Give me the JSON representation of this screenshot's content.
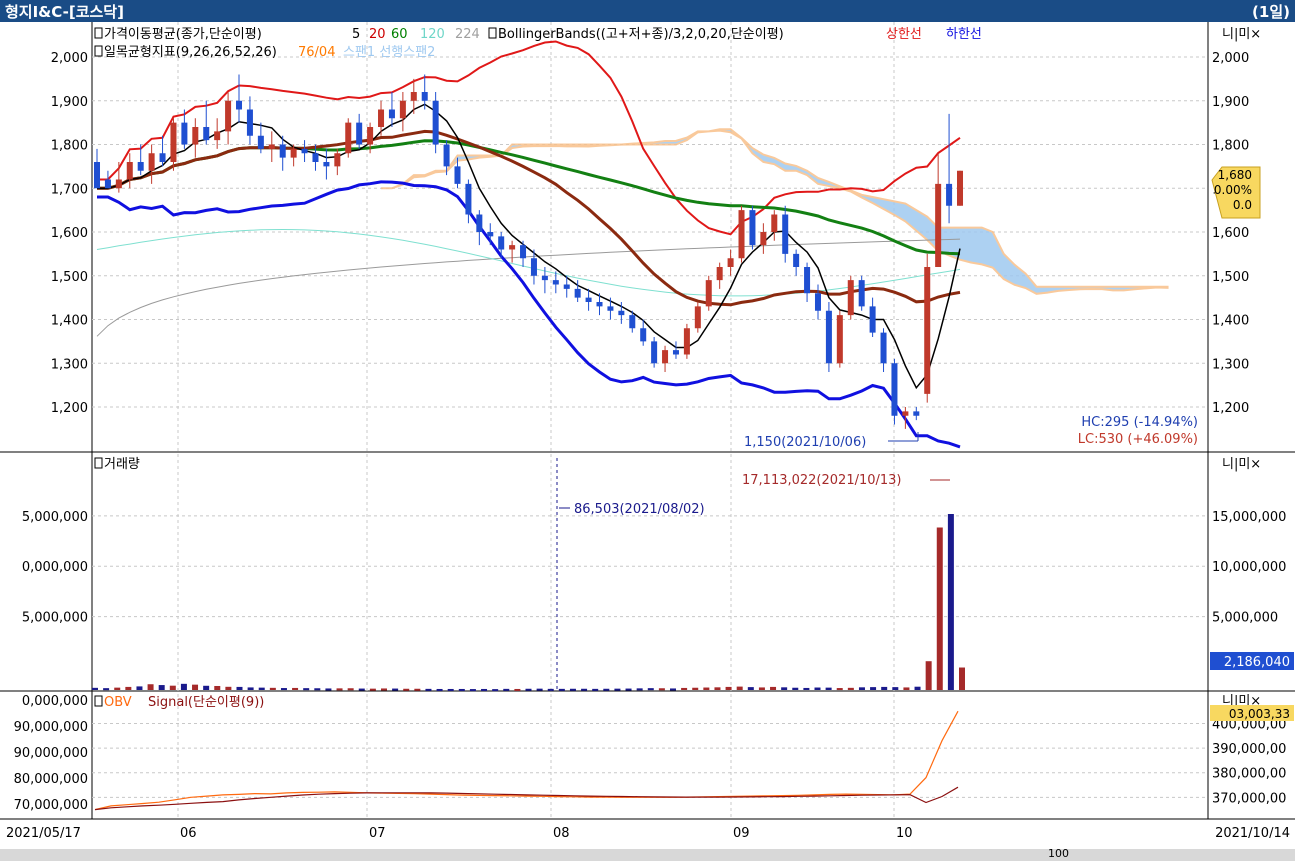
{
  "window": {
    "title": "형지I&C-[코스닥]",
    "period": "(1일)"
  },
  "panels": {
    "price": {
      "ma_label": "가격이동평균(종가,단순이평)",
      "ma_periods": [
        {
          "label": "5",
          "color": "#000000"
        },
        {
          "label": "20",
          "color": "#cc0000"
        },
        {
          "label": "60",
          "color": "#008000"
        },
        {
          "label": "120",
          "color": "#6fd6c8"
        },
        {
          "label": "224",
          "color": "#a0a0a0"
        }
      ],
      "bb_label": "BollingerBands((고+저+종)/3,2,0,20,단순이평)",
      "bb_upper_label": "상한선",
      "bb_lower_label": "하한선",
      "ichimoku_label": "일목균형지표(9,26,26,52,26)",
      "ichimoku_overlap": "76/04",
      "span_labels": "스팬1 선행스팬2",
      "y_ticks": [
        "2,000",
        "1,900",
        "1,800",
        "1,700",
        "1,600",
        "1,500",
        "1,400",
        "1,300",
        "1,200"
      ],
      "current_value": "1,680",
      "current_change": "0.00%",
      "current_diff": "0.0",
      "low_marker": "1,150(2021/10/06)",
      "hc_label": "HC:295 (-14.94%)",
      "lc_label": "LC:530 (+46.09%)"
    },
    "volume": {
      "label": "거래량",
      "y_ticks_left": [
        "5,000,000",
        "0,000,000",
        "5,000,000"
      ],
      "y_ticks_right": [
        "15,000,000",
        "10,000,000",
        "5,000,000"
      ],
      "max_marker": "17,113,022(2021/10/13)",
      "min_marker": "86,503(2021/08/02)",
      "current_value": "2,186,040"
    },
    "obv": {
      "label": "OBV",
      "signal_label": "Signal(단순이평(9))",
      "y_ticks_left": [
        "0,000,000",
        "90,000,000",
        "90,000,000",
        "80,000,000",
        "70,000,000"
      ],
      "y_ticks_right": [
        "400,000,00",
        "390,000,00",
        "380,000,00",
        "370,000,00"
      ],
      "current_value": "03,003,33"
    }
  },
  "x_axis": {
    "start_date": "2021/05/17",
    "end_date": "2021/10/14",
    "months": [
      "06",
      "07",
      "08",
      "09",
      "10"
    ]
  },
  "panel_controls": "니|미×",
  "bottom": {
    "zoom_value": "100"
  },
  "colors": {
    "up": "#c0392b",
    "down": "#1f4fd1",
    "bb_upper": "#e01818",
    "bb_lower": "#1010e0",
    "ma5": "#000000",
    "ma20": "#8b2a10",
    "ma60": "#138013",
    "ma120": "#7fe0d0",
    "ma224": "#9a9a9a",
    "cloud_up": "#f8c08a",
    "cloud_down": "#9fc9f0",
    "obv": "#ff6a10",
    "signal": "#8b1010",
    "vol_up": "#a52a2a",
    "vol_down": "#1a1a8c"
  },
  "chart_data": {
    "type": "candlestick",
    "title": "형지I&C-[코스닥]",
    "x_range": [
      "2021/05/17",
      "2021/10/14"
    ],
    "y_range": [
      1150,
      2030
    ],
    "grid": true,
    "candles": [
      [
        1760,
        1790,
        1720,
        1700
      ],
      [
        1720,
        1740,
        1700,
        1700
      ],
      [
        1700,
        1760,
        1690,
        1720
      ],
      [
        1720,
        1780,
        1700,
        1760
      ],
      [
        1760,
        1800,
        1730,
        1740
      ],
      [
        1740,
        1800,
        1710,
        1780
      ],
      [
        1780,
        1820,
        1750,
        1760
      ],
      [
        1760,
        1860,
        1740,
        1850
      ],
      [
        1850,
        1880,
        1790,
        1800
      ],
      [
        1800,
        1860,
        1770,
        1840
      ],
      [
        1840,
        1900,
        1800,
        1810
      ],
      [
        1810,
        1860,
        1790,
        1830
      ],
      [
        1830,
        1920,
        1800,
        1900
      ],
      [
        1900,
        1960,
        1850,
        1880
      ],
      [
        1880,
        1910,
        1800,
        1820
      ],
      [
        1820,
        1850,
        1780,
        1790
      ],
      [
        1790,
        1830,
        1760,
        1800
      ],
      [
        1800,
        1820,
        1740,
        1770
      ],
      [
        1770,
        1800,
        1750,
        1790
      ],
      [
        1790,
        1810,
        1760,
        1780
      ],
      [
        1780,
        1800,
        1740,
        1760
      ],
      [
        1760,
        1790,
        1720,
        1750
      ],
      [
        1750,
        1790,
        1730,
        1780
      ],
      [
        1780,
        1860,
        1770,
        1850
      ],
      [
        1850,
        1870,
        1790,
        1800
      ],
      [
        1800,
        1850,
        1780,
        1840
      ],
      [
        1840,
        1900,
        1820,
        1880
      ],
      [
        1880,
        1920,
        1840,
        1860
      ],
      [
        1860,
        1920,
        1830,
        1900
      ],
      [
        1900,
        1950,
        1870,
        1920
      ],
      [
        1920,
        1960,
        1880,
        1900
      ],
      [
        1900,
        1920,
        1780,
        1800
      ],
      [
        1800,
        1810,
        1730,
        1750
      ],
      [
        1750,
        1770,
        1700,
        1710
      ],
      [
        1710,
        1720,
        1620,
        1640
      ],
      [
        1640,
        1650,
        1570,
        1600
      ],
      [
        1600,
        1620,
        1570,
        1590
      ],
      [
        1590,
        1600,
        1540,
        1560
      ],
      [
        1560,
        1580,
        1530,
        1570
      ],
      [
        1570,
        1580,
        1520,
        1540
      ],
      [
        1540,
        1560,
        1480,
        1500
      ],
      [
        1500,
        1520,
        1460,
        1490
      ],
      [
        1490,
        1510,
        1460,
        1480
      ],
      [
        1480,
        1500,
        1450,
        1470
      ],
      [
        1470,
        1490,
        1440,
        1450
      ],
      [
        1450,
        1470,
        1420,
        1440
      ],
      [
        1440,
        1460,
        1410,
        1430
      ],
      [
        1430,
        1450,
        1400,
        1420
      ],
      [
        1420,
        1440,
        1390,
        1410
      ],
      [
        1410,
        1420,
        1370,
        1380
      ],
      [
        1380,
        1400,
        1340,
        1350
      ],
      [
        1350,
        1360,
        1290,
        1300
      ],
      [
        1300,
        1340,
        1280,
        1330
      ],
      [
        1330,
        1350,
        1310,
        1320
      ],
      [
        1320,
        1390,
        1310,
        1380
      ],
      [
        1380,
        1440,
        1370,
        1430
      ],
      [
        1430,
        1500,
        1420,
        1490
      ],
      [
        1490,
        1530,
        1470,
        1520
      ],
      [
        1520,
        1560,
        1500,
        1540
      ],
      [
        1540,
        1660,
        1530,
        1650
      ],
      [
        1650,
        1660,
        1560,
        1570
      ],
      [
        1570,
        1620,
        1550,
        1600
      ],
      [
        1600,
        1650,
        1580,
        1640
      ],
      [
        1640,
        1660,
        1530,
        1550
      ],
      [
        1550,
        1560,
        1500,
        1520
      ],
      [
        1520,
        1530,
        1440,
        1460
      ],
      [
        1460,
        1480,
        1400,
        1420
      ],
      [
        1420,
        1440,
        1280,
        1300
      ],
      [
        1300,
        1420,
        1290,
        1410
      ],
      [
        1410,
        1500,
        1400,
        1490
      ],
      [
        1490,
        1500,
        1420,
        1430
      ],
      [
        1430,
        1450,
        1360,
        1370
      ],
      [
        1370,
        1380,
        1280,
        1300
      ],
      [
        1300,
        1310,
        1160,
        1180
      ],
      [
        1180,
        1200,
        1150,
        1190
      ],
      [
        1190,
        1200,
        1170,
        1180
      ],
      [
        1230,
        1550,
        1210,
        1520
      ],
      [
        1520,
        1780,
        1600,
        1710
      ],
      [
        1710,
        1870,
        1620,
        1660
      ],
      [
        1660,
        1740,
        1660,
        1740
      ]
    ],
    "volume": [
      210000,
      180000,
      230000,
      300000,
      350000,
      560000,
      480000,
      420000,
      600000,
      520000,
      410000,
      390000,
      310000,
      300000,
      250000,
      230000,
      210000,
      190000,
      200000,
      180000,
      170000,
      150000,
      160000,
      170000,
      140000,
      130000,
      150000,
      140000,
      120000,
      120000,
      110000,
      100000,
      100000,
      100000,
      90000,
      100000,
      86503,
      110000,
      100000,
      120000,
      130000,
      110000,
      110000,
      120000,
      120000,
      110000,
      120000,
      130000,
      140000,
      160000,
      180000,
      170000,
      150000,
      200000,
      220000,
      240000,
      260000,
      300000,
      330000,
      280000,
      250000,
      300000,
      260000,
      220000,
      200000,
      240000,
      230000,
      190000,
      210000,
      260000,
      280000,
      300000,
      280000,
      250000,
      320000,
      2800000,
      15800000,
      17113022,
      2186040
    ],
    "obv": [
      365000000,
      366500000,
      367000000,
      367500000,
      368000000,
      369000000,
      370000000,
      370500000,
      371000000,
      371200000,
      371500000,
      371400000,
      371800000,
      372000000,
      372100000,
      372200000,
      372000000,
      371800000,
      371700000,
      371600000,
      371500000,
      371300000,
      371100000,
      370900000,
      370800000,
      370700000,
      370600000,
      370500000,
      370400000,
      370300000,
      370200000,
      370100000,
      370100000,
      370000000,
      370000000,
      370000000,
      370000000,
      370100000,
      370200000,
      370300000,
      370400000,
      370500000,
      370600000,
      370700000,
      370800000,
      371000000,
      371200000,
      371300000,
      371200000,
      371100000,
      371000000,
      371300000,
      378000000,
      393000000,
      405000000
    ]
  }
}
